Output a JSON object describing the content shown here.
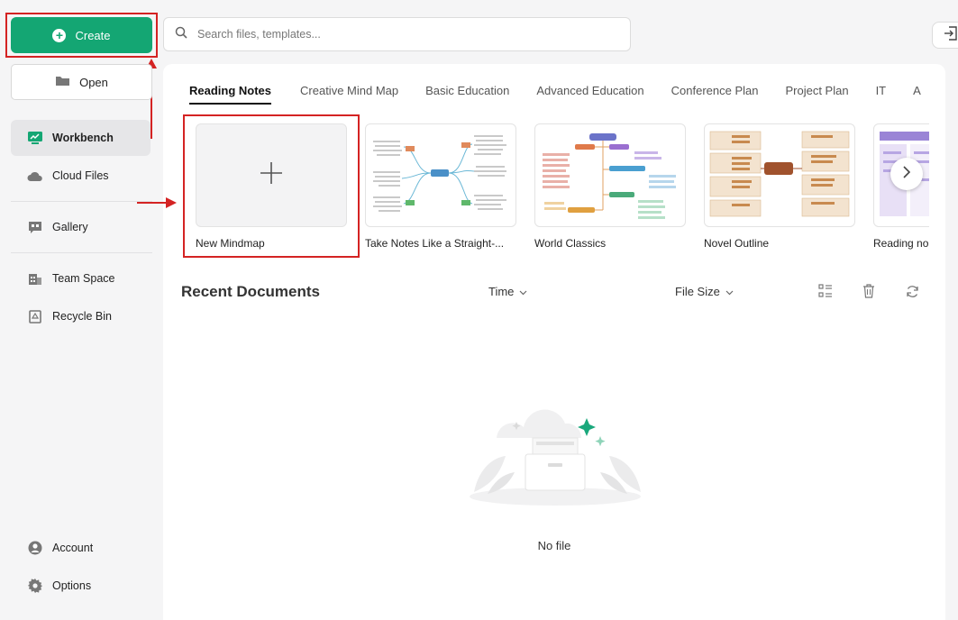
{
  "sidebar": {
    "create_label": "Create",
    "open_label": "Open",
    "nav": [
      {
        "label": "Workbench",
        "icon": "workbench-icon",
        "active": true
      },
      {
        "label": "Cloud Files",
        "icon": "cloud-icon"
      },
      {
        "label": "Gallery",
        "icon": "gallery-icon"
      },
      {
        "label": "Team Space",
        "icon": "team-space-icon"
      },
      {
        "label": "Recycle Bin",
        "icon": "recycle-bin-icon"
      }
    ],
    "bottom": [
      {
        "label": "Account",
        "icon": "account-icon"
      },
      {
        "label": "Options",
        "icon": "gear-icon"
      }
    ]
  },
  "search": {
    "placeholder": "Search files, templates..."
  },
  "tabs": [
    "Reading Notes",
    "Creative Mind Map",
    "Basic Education",
    "Advanced Education",
    "Conference Plan",
    "Project Plan",
    "IT",
    "A"
  ],
  "templates": [
    {
      "label": "New Mindmap"
    },
    {
      "label": "Take Notes Like a Straight-..."
    },
    {
      "label": "World Classics"
    },
    {
      "label": "Novel Outline"
    },
    {
      "label": "Reading no"
    }
  ],
  "recent": {
    "title": "Recent Documents",
    "sort_time": "Time",
    "sort_size": "File Size",
    "empty_text": "No file"
  },
  "colors": {
    "accent": "#14a673",
    "highlight": "#d42323"
  }
}
